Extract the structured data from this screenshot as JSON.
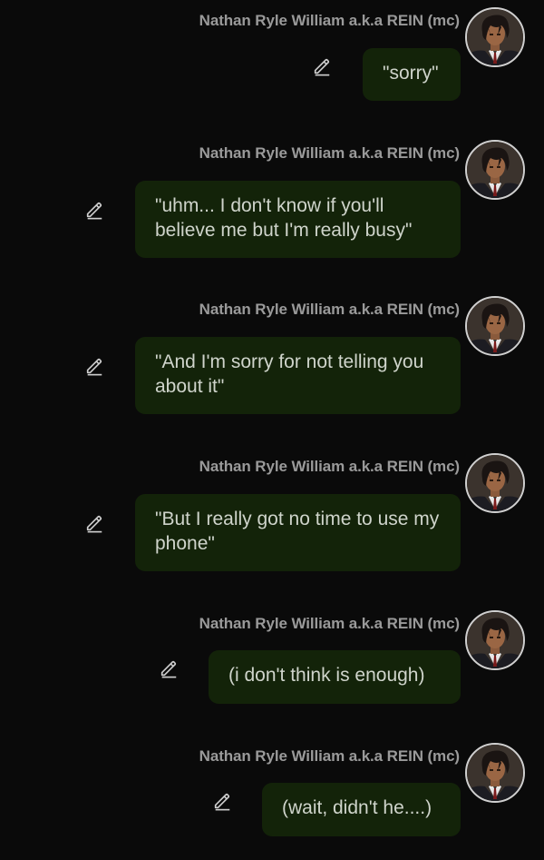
{
  "colors": {
    "background": "#0a0a0a",
    "bubble": "#132309",
    "bubble_text": "#cfd4cb",
    "sender_text": "#9a9a9a"
  },
  "messages": [
    {
      "sender": "Nathan Ryle William a.k.a REIN (mc)",
      "text": "\"sorry\"",
      "icon": "pencil-edit-icon"
    },
    {
      "sender": "Nathan Ryle William a.k.a REIN (mc)",
      "text": "\"uhm... I don't know if you'll believe me but I'm really busy\"",
      "icon": "pencil-edit-icon"
    },
    {
      "sender": "Nathan Ryle William a.k.a REIN (mc)",
      "text": "\"And I'm sorry for not telling you about it\"",
      "icon": "pencil-edit-icon"
    },
    {
      "sender": "Nathan Ryle William a.k.a REIN (mc)",
      "text": "\"But I really got no time to use my phone\"",
      "icon": "pencil-edit-icon"
    },
    {
      "sender": "Nathan Ryle William a.k.a REIN (mc)",
      "text": "(i don't think is enough)",
      "icon": "pencil-edit-icon"
    },
    {
      "sender": "Nathan Ryle William a.k.a REIN (mc)",
      "text": "(wait, didn't he....)",
      "icon": "pencil-edit-icon"
    }
  ]
}
